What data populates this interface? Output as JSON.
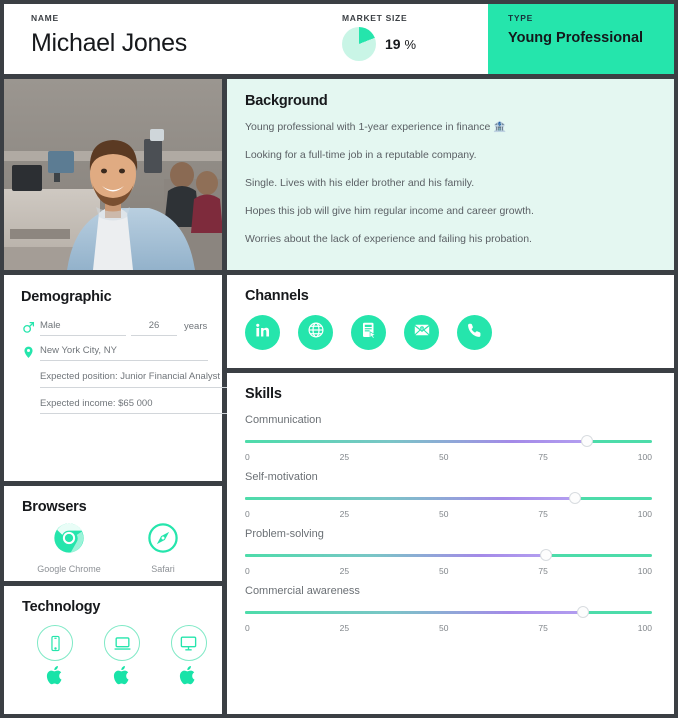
{
  "header": {
    "name_label": "NAME",
    "name_value": "Michael Jones",
    "market_label": "MARKET SIZE",
    "market_value": "19",
    "market_unit": "%",
    "market_percent": 19,
    "type_label": "TYPE",
    "type_value": "Young Professional"
  },
  "photo": {
    "alt": "Smiling young professional man in denim shirt standing in an open-plan office"
  },
  "background": {
    "title": "Background",
    "lines": [
      "Young professional with 1-year experience in finance 🏦",
      "Looking for a full-time job in a reputable company.",
      "Single. Lives with his elder brother and his family.",
      "Hopes this job will give him regular income and career growth.",
      "Worries about the lack of experience and failing his probation."
    ]
  },
  "demographic": {
    "title": "Demographic",
    "gender": "Male",
    "age": "26",
    "age_unit": "years",
    "location": "New York City, NY",
    "position": "Expected position: Junior Financial Analyst",
    "income": "Expected income: $65 000"
  },
  "channels": {
    "title": "Channels",
    "items": [
      {
        "name": "linkedin-icon",
        "label": "LinkedIn"
      },
      {
        "name": "globe-icon",
        "label": "Website"
      },
      {
        "name": "form-icon",
        "label": "Online form"
      },
      {
        "name": "email-icon",
        "label": "Email"
      },
      {
        "name": "phone-icon",
        "label": "Phone"
      }
    ]
  },
  "skills": {
    "title": "Skills",
    "axis_ticks": [
      "0",
      "25",
      "50",
      "75",
      "100"
    ],
    "items": [
      {
        "label": "Communication",
        "value": 84
      },
      {
        "label": "Self-motivation",
        "value": 81
      },
      {
        "label": "Problem-solving",
        "value": 74
      },
      {
        "label": "Commercial awareness",
        "value": 83
      }
    ]
  },
  "browsers": {
    "title": "Browsers",
    "items": [
      {
        "name": "chrome-icon",
        "label": "Google Chrome"
      },
      {
        "name": "safari-icon",
        "label": "Safari"
      }
    ]
  },
  "technology": {
    "title": "Technology",
    "items": [
      {
        "device": "smartphone-icon",
        "brand": "apple-logo-icon"
      },
      {
        "device": "laptop-icon",
        "brand": "apple-logo-icon"
      },
      {
        "device": "desktop-monitor-icon",
        "brand": "apple-logo-icon"
      }
    ]
  },
  "chart_data": {
    "type": "bar",
    "title": "Skills",
    "categories": [
      "Communication",
      "Self-motivation",
      "Problem-solving",
      "Commercial awareness"
    ],
    "values": [
      84,
      81,
      74,
      83
    ],
    "xlabel": "",
    "ylabel": "",
    "xlim": [
      0,
      100
    ],
    "ticks": [
      0,
      25,
      50,
      75,
      100
    ],
    "grid": false,
    "legend": "none"
  },
  "colors": {
    "accent": "#25E5AC",
    "accent_soft": "#C9F5E6",
    "page_bg": "#3B3F44",
    "card_bg": "#FFFFFF",
    "background_card_bg": "#E4F7F1",
    "slider_end": "#A48AE8",
    "text_dark": "#17191C",
    "text_muted": "#70757A"
  }
}
